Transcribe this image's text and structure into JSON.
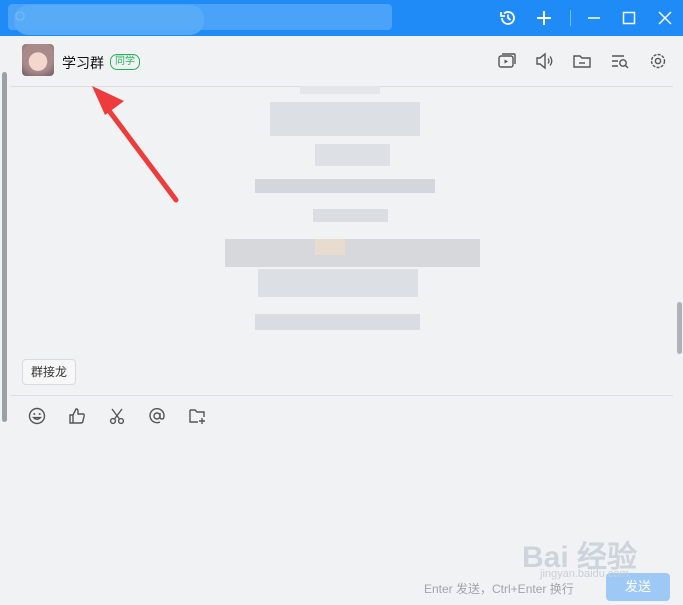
{
  "titlebar": {
    "search_placeholder": "",
    "icons": [
      "history-icon",
      "plus-icon",
      "minimize-icon",
      "maximize-icon",
      "close-icon"
    ]
  },
  "chat": {
    "group_name": "学习群",
    "group_tag": "同学",
    "header_icons": [
      "video-call-icon",
      "speaker-icon",
      "folder-icon",
      "chat-search-icon",
      "settings-icon"
    ]
  },
  "quick_actions": {
    "chip_label": "群接龙"
  },
  "toolbar": {
    "icons": [
      "emoji-icon",
      "like-icon",
      "scissors-icon",
      "at-icon",
      "add-folder-icon"
    ]
  },
  "input": {
    "hint": "Enter 发送，Ctrl+Enter 换行",
    "send_label": "发送"
  },
  "watermark": {
    "text": "Bai 经验",
    "sub": "jingyan.baidu.com"
  },
  "colors": {
    "titlebar": "#1e8bf7",
    "tag_green": "#27b35a",
    "arrow_red": "#ee3b3b"
  }
}
